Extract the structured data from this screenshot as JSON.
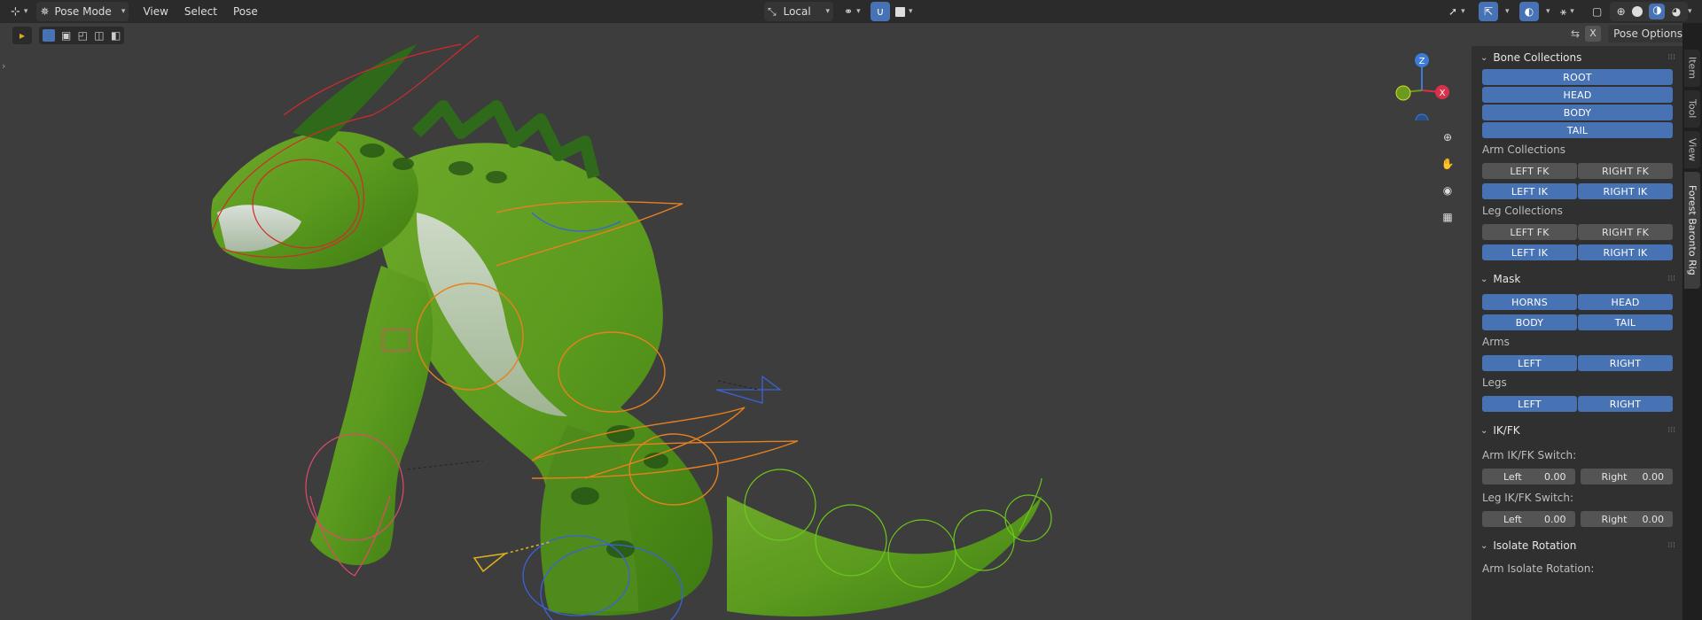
{
  "header": {
    "mode": "Pose Mode",
    "menus": [
      "View",
      "Select",
      "Pose"
    ],
    "transform_orientation": "Local",
    "options_label": "Pose Options",
    "x_mirror_label": "X"
  },
  "sidebar": {
    "tabs": [
      "Item",
      "Tool",
      "View",
      "Forest Baronto Rig"
    ],
    "bone_collections": {
      "title": "Bone Collections",
      "main": [
        "ROOT",
        "HEAD",
        "BODY",
        "TAIL"
      ],
      "arm_label": "Arm Collections",
      "arm_fk": [
        "LEFT FK",
        "RIGHT FK"
      ],
      "arm_ik": [
        "LEFT IK",
        "RIGHT IK"
      ],
      "leg_label": "Leg Collections",
      "leg_fk": [
        "LEFT FK",
        "RIGHT FK"
      ],
      "leg_ik": [
        "LEFT IK",
        "RIGHT IK"
      ]
    },
    "mask": {
      "title": "Mask",
      "row1": [
        "HORNS",
        "HEAD"
      ],
      "row2": [
        "BODY",
        "TAIL"
      ],
      "arms_label": "Arms",
      "arms": [
        "LEFT",
        "RIGHT"
      ],
      "legs_label": "Legs",
      "legs": [
        "LEFT",
        "RIGHT"
      ]
    },
    "ikfk": {
      "title": "IK/FK",
      "arm_label": "Arm IK/FK Switch:",
      "arm_left": {
        "label": "Left",
        "value": "0.00"
      },
      "arm_right": {
        "label": "Right",
        "value": "0.00"
      },
      "leg_label": "Leg IK/FK Switch:",
      "leg_left": {
        "label": "Left",
        "value": "0.00"
      },
      "leg_right": {
        "label": "Right",
        "value": "0.00"
      }
    },
    "isolate": {
      "title": "Isolate Rotation",
      "arm_label": "Arm Isolate Rotation:"
    }
  },
  "gizmo": {
    "z": "Z",
    "x": "X"
  },
  "colors": {
    "accent": "#4772b3",
    "panel": "#303030",
    "viewport": "#3d3d3d",
    "header": "#2b2b2b"
  }
}
